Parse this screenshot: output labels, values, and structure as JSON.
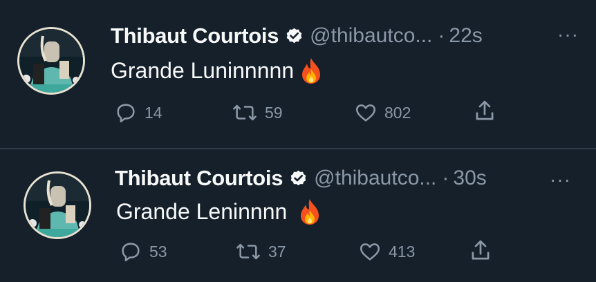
{
  "tweets": [
    {
      "author": "Thibaut Courtois",
      "handle": "@thibautco...",
      "separator": "·",
      "time": "22s",
      "more": "···",
      "text": "Grande Luninnnnn",
      "emoji": "fire-emoji",
      "replies": "14",
      "retweets": "59",
      "likes": "802"
    },
    {
      "author": "Thibaut Courtois",
      "handle": "@thibautco...",
      "separator": "·",
      "time": "30s",
      "more": "···",
      "text": "Grande Leninnnn",
      "emoji": "fire-emoji",
      "replies": "53",
      "retweets": "37",
      "likes": "413"
    }
  ],
  "colors": {
    "background": "#15202b",
    "text": "#f7f9f9",
    "muted": "#8b98a5",
    "divider": "#2f3b47"
  }
}
